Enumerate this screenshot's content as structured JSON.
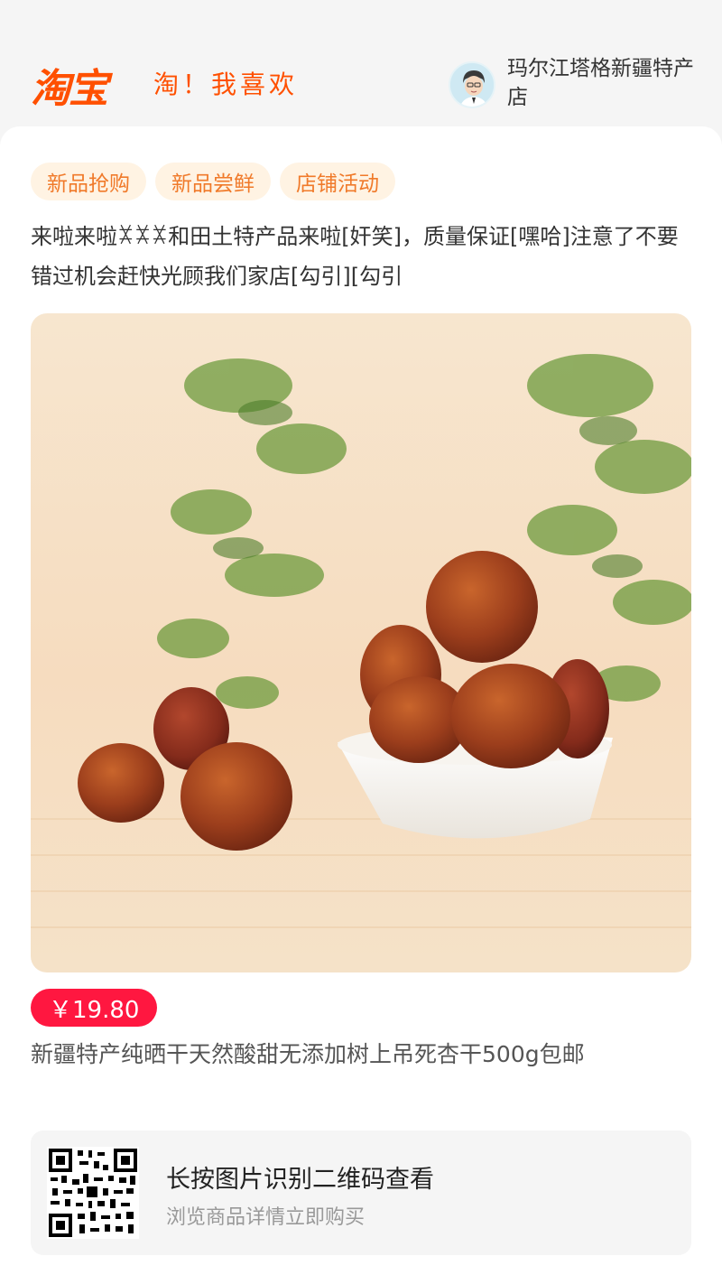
{
  "header": {
    "logo": "淘宝",
    "slogan": "淘！我喜欢",
    "store_name": "玛尔江塔格新疆特产店"
  },
  "tags": [
    "新品抢购",
    "新品尝鲜",
    "店铺活动"
  ],
  "description": "来啦来啦ꁿꁿꁿ和田土特产品来啦[奸笑]，质量保证[嘿哈]注意了不要错过机会赶快光顾我们家店[勾引][勾引",
  "product": {
    "price": "￥19.80",
    "title": "新疆特产纯晒干天然酸甜无添加树上吊死杏干500g包邮"
  },
  "qr": {
    "title": "长按图片识别二维码查看",
    "subtitle": "浏览商品详情立即购买"
  },
  "colors": {
    "brand": "#ff5000",
    "price_bg": "#ff1740",
    "tag_bg": "#fff3e3",
    "tag_text": "#f07a2a"
  }
}
